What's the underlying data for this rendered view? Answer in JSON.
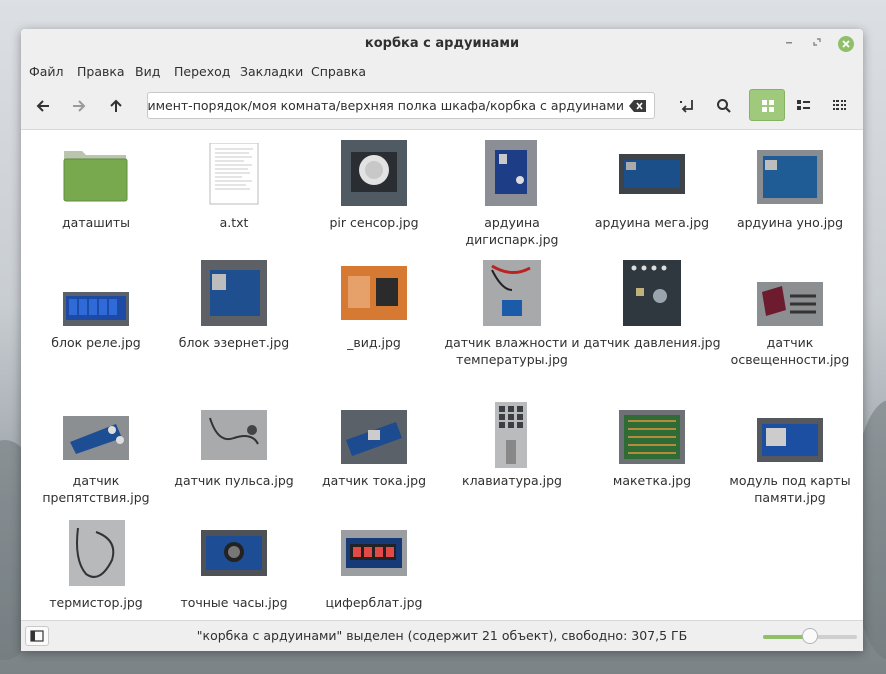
{
  "window": {
    "title": "корбка с ардуинами"
  },
  "menu": [
    "Файл",
    "Правка",
    "Вид",
    "Переход",
    "Закладки",
    "Справка"
  ],
  "toolbar": {
    "path": "/home/user/эксперимент-порядок/моя комната/верхняя полка шкафа/корбка с ардуинами"
  },
  "files": [
    {
      "name": "даташиты",
      "kind": "folder",
      "icon": "folder-icon"
    },
    {
      "name": "a.txt",
      "kind": "text",
      "icon": "text-file-icon"
    },
    {
      "name": "pir сенсор.jpg",
      "kind": "image",
      "icon": "image-thumbnail"
    },
    {
      "name": "ардуина дигиспарк.jpg",
      "kind": "image",
      "icon": "image-thumbnail"
    },
    {
      "name": "ардуина мега.jpg",
      "kind": "image",
      "icon": "image-thumbnail"
    },
    {
      "name": "ардуина уно.jpg",
      "kind": "image",
      "icon": "image-thumbnail"
    },
    {
      "name": "блок реле.jpg",
      "kind": "image",
      "icon": "image-thumbnail"
    },
    {
      "name": "блок эзернет.jpg",
      "kind": "image",
      "icon": "image-thumbnail"
    },
    {
      "name": "_вид.jpg",
      "kind": "image",
      "icon": "image-thumbnail"
    },
    {
      "name": "датчик влажности и температуры.jpg",
      "kind": "image",
      "icon": "image-thumbnail"
    },
    {
      "name": "датчик давления.jpg",
      "kind": "image",
      "icon": "image-thumbnail"
    },
    {
      "name": "датчик освещенности.jpg",
      "kind": "image",
      "icon": "image-thumbnail"
    },
    {
      "name": "датчик препятствия.jpg",
      "kind": "image",
      "icon": "image-thumbnail"
    },
    {
      "name": "датчик пульса.jpg",
      "kind": "image",
      "icon": "image-thumbnail"
    },
    {
      "name": "датчик тока.jpg",
      "kind": "image",
      "icon": "image-thumbnail"
    },
    {
      "name": "клавиатура.jpg",
      "kind": "image",
      "icon": "image-thumbnail"
    },
    {
      "name": "макетка.jpg",
      "kind": "image",
      "icon": "image-thumbnail"
    },
    {
      "name": "модуль под карты памяти.jpg",
      "kind": "image",
      "icon": "image-thumbnail"
    },
    {
      "name": "термистор.jpg",
      "kind": "image",
      "icon": "image-thumbnail"
    },
    {
      "name": "точные часы.jpg",
      "kind": "image",
      "icon": "image-thumbnail"
    },
    {
      "name": "циферблат.jpg",
      "kind": "image",
      "icon": "image-thumbnail"
    }
  ],
  "status": {
    "text": "\"корбка с ардуинами\" выделен (содержит 21 объект), свободно: 307,5 ГБ",
    "zoom_level": 0.5
  },
  "colors": {
    "accent": "#8fc069",
    "folder": "#79a94f"
  }
}
